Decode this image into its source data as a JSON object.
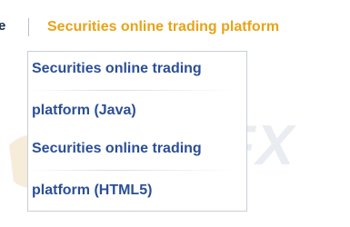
{
  "nav": {
    "prev_item_label": "e",
    "active_item_label": "Securities online trading platform"
  },
  "dropdown": {
    "items": [
      {
        "label_line1": "Securities online trading",
        "label_line2": "platform (Java)"
      },
      {
        "label_line1": "Securities online trading",
        "label_line2": "platform (HTML5)"
      }
    ]
  },
  "watermark": {
    "logo_text": "WikiFX"
  },
  "colors": {
    "active": "#e8a317",
    "link": "#2b4f96",
    "nav_text": "#1a2a4a"
  }
}
